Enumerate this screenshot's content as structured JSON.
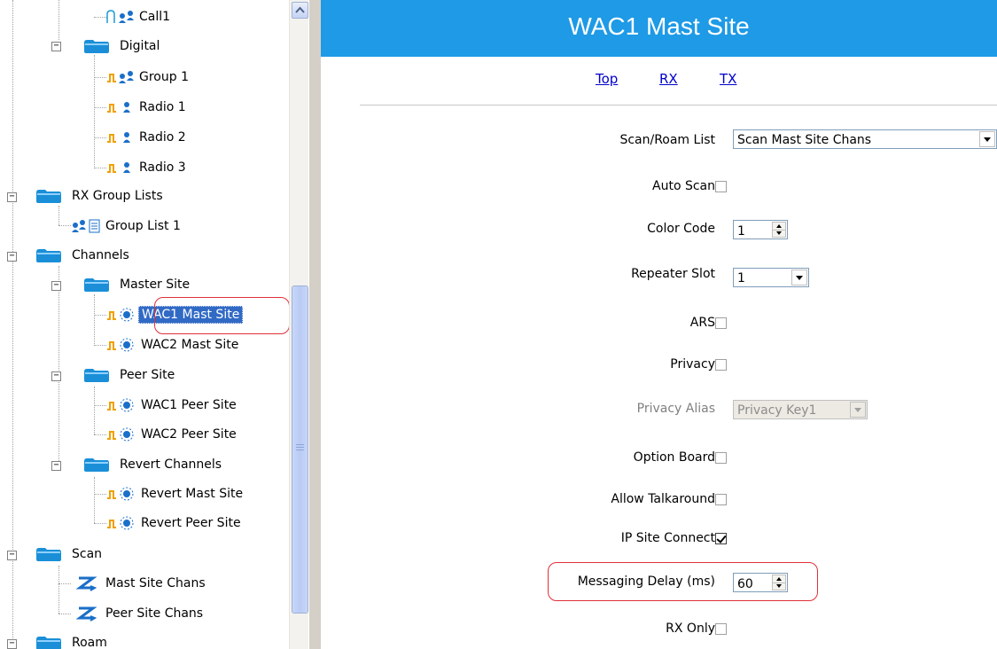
{
  "tree": {
    "items": [
      {
        "label": "Call1",
        "icon": "analog-call-icon"
      },
      {
        "label": "Digital",
        "icon": "folder-icon"
      },
      {
        "label": "Group 1",
        "icon": "digital-group-icon"
      },
      {
        "label": "Radio 1",
        "icon": "digital-radio-icon"
      },
      {
        "label": "Radio 2",
        "icon": "digital-radio-icon"
      },
      {
        "label": "Radio 3",
        "icon": "digital-radio-icon"
      },
      {
        "label": "RX Group Lists",
        "icon": "folder-icon"
      },
      {
        "label": "Group List 1",
        "icon": "group-list-icon"
      },
      {
        "label": "Channels",
        "icon": "folder-icon"
      },
      {
        "label": "Master Site",
        "icon": "folder-icon"
      },
      {
        "label": "WAC1 Mast Site",
        "icon": "digital-channel-icon"
      },
      {
        "label": "WAC2 Mast Site",
        "icon": "digital-channel-icon"
      },
      {
        "label": "Peer Site",
        "icon": "folder-icon"
      },
      {
        "label": "WAC1 Peer Site",
        "icon": "digital-channel-icon"
      },
      {
        "label": "WAC2 Peer Site",
        "icon": "digital-channel-icon"
      },
      {
        "label": "Revert Channels",
        "icon": "folder-icon"
      },
      {
        "label": "Revert Mast Site",
        "icon": "digital-channel-icon"
      },
      {
        "label": "Revert Peer Site",
        "icon": "digital-channel-icon"
      },
      {
        "label": "Scan",
        "icon": "folder-icon"
      },
      {
        "label": "Mast Site Chans",
        "icon": "scan-list-icon"
      },
      {
        "label": "Peer Site Chans",
        "icon": "scan-list-icon"
      },
      {
        "label": "Roam",
        "icon": "folder-icon"
      }
    ],
    "toggle_symbol": "−"
  },
  "panel": {
    "title": "WAC1 Mast Site",
    "links": [
      "Top",
      "RX",
      "TX"
    ],
    "fields": {
      "scan_roam_list": {
        "label": "Scan/Roam List",
        "value": "Scan Mast Site Chans"
      },
      "auto_scan": {
        "label": "Auto Scan",
        "checked": false
      },
      "color_code": {
        "label": "Color Code",
        "value": "1"
      },
      "repeater_slot": {
        "label": "Repeater Slot",
        "value": "1"
      },
      "ars": {
        "label": "ARS",
        "checked": false
      },
      "privacy": {
        "label": "Privacy",
        "checked": false
      },
      "privacy_alias": {
        "label": "Privacy Alias",
        "value": "Privacy Key1"
      },
      "option_board": {
        "label": "Option Board",
        "checked": false
      },
      "allow_talkaround": {
        "label": "Allow Talkaround",
        "checked": false
      },
      "ip_site_connect": {
        "label": "IP Site Connect",
        "checked": true
      },
      "messaging_delay": {
        "label": "Messaging Delay (ms)",
        "value": "60"
      },
      "rx_only": {
        "label": "RX Only",
        "checked": false
      }
    }
  },
  "colors": {
    "title_bar": "#1e9ae6",
    "selection": "#316ac5",
    "highlight": "#e0303a",
    "link": "#0000cc"
  }
}
